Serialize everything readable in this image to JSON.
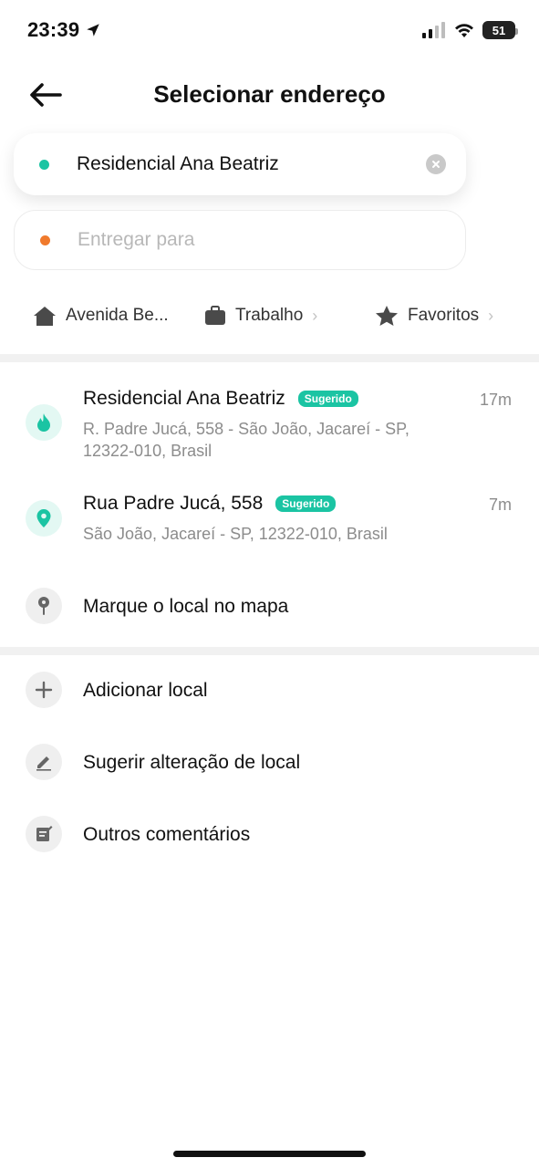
{
  "status_bar": {
    "time": "23:39",
    "battery": "51",
    "icons": [
      "location-arrow-icon",
      "signal-icon",
      "wifi-icon",
      "battery-icon"
    ]
  },
  "header": {
    "title": "Selecionar endereço",
    "back_icon": "back-arrow-icon"
  },
  "origin": {
    "value": "Residencial Ana Beatriz",
    "dot_color": "#1bc4a3"
  },
  "destination": {
    "placeholder": "Entregar para",
    "dot_color": "#f07a2c"
  },
  "shortcuts": [
    {
      "label": "Avenida Be...",
      "icon": "home-icon"
    },
    {
      "label": "Trabalho",
      "icon": "briefcase-icon"
    },
    {
      "label": "Favoritos",
      "icon": "star-icon"
    }
  ],
  "suggestions": [
    {
      "title": "Residencial Ana Beatriz",
      "badge": "Sugerido",
      "address_line1": "R. Padre Jucá, 558 - São João, Jacareí - SP,",
      "address_line2": "12322-010, Brasil",
      "eta": "17m",
      "icon": "flame-icon"
    },
    {
      "title": "Rua Padre Jucá, 558",
      "badge": "Sugerido",
      "address_line1": "São João, Jacareí - SP, 12322-010, Brasil",
      "eta": "7m",
      "icon": "map-pin-icon"
    }
  ],
  "map_option": {
    "label": "Marque o local no mapa",
    "icon": "map-pin-gray-icon"
  },
  "actions": [
    {
      "label": "Adicionar local",
      "icon": "plus-icon"
    },
    {
      "label": "Sugerir alteração de local",
      "icon": "pencil-icon"
    },
    {
      "label": "Outros comentários",
      "icon": "note-icon"
    }
  ],
  "colors": {
    "accent": "#1bc4a3",
    "destination_dot": "#f07a2c",
    "badge_bg": "#1bc4a3"
  }
}
